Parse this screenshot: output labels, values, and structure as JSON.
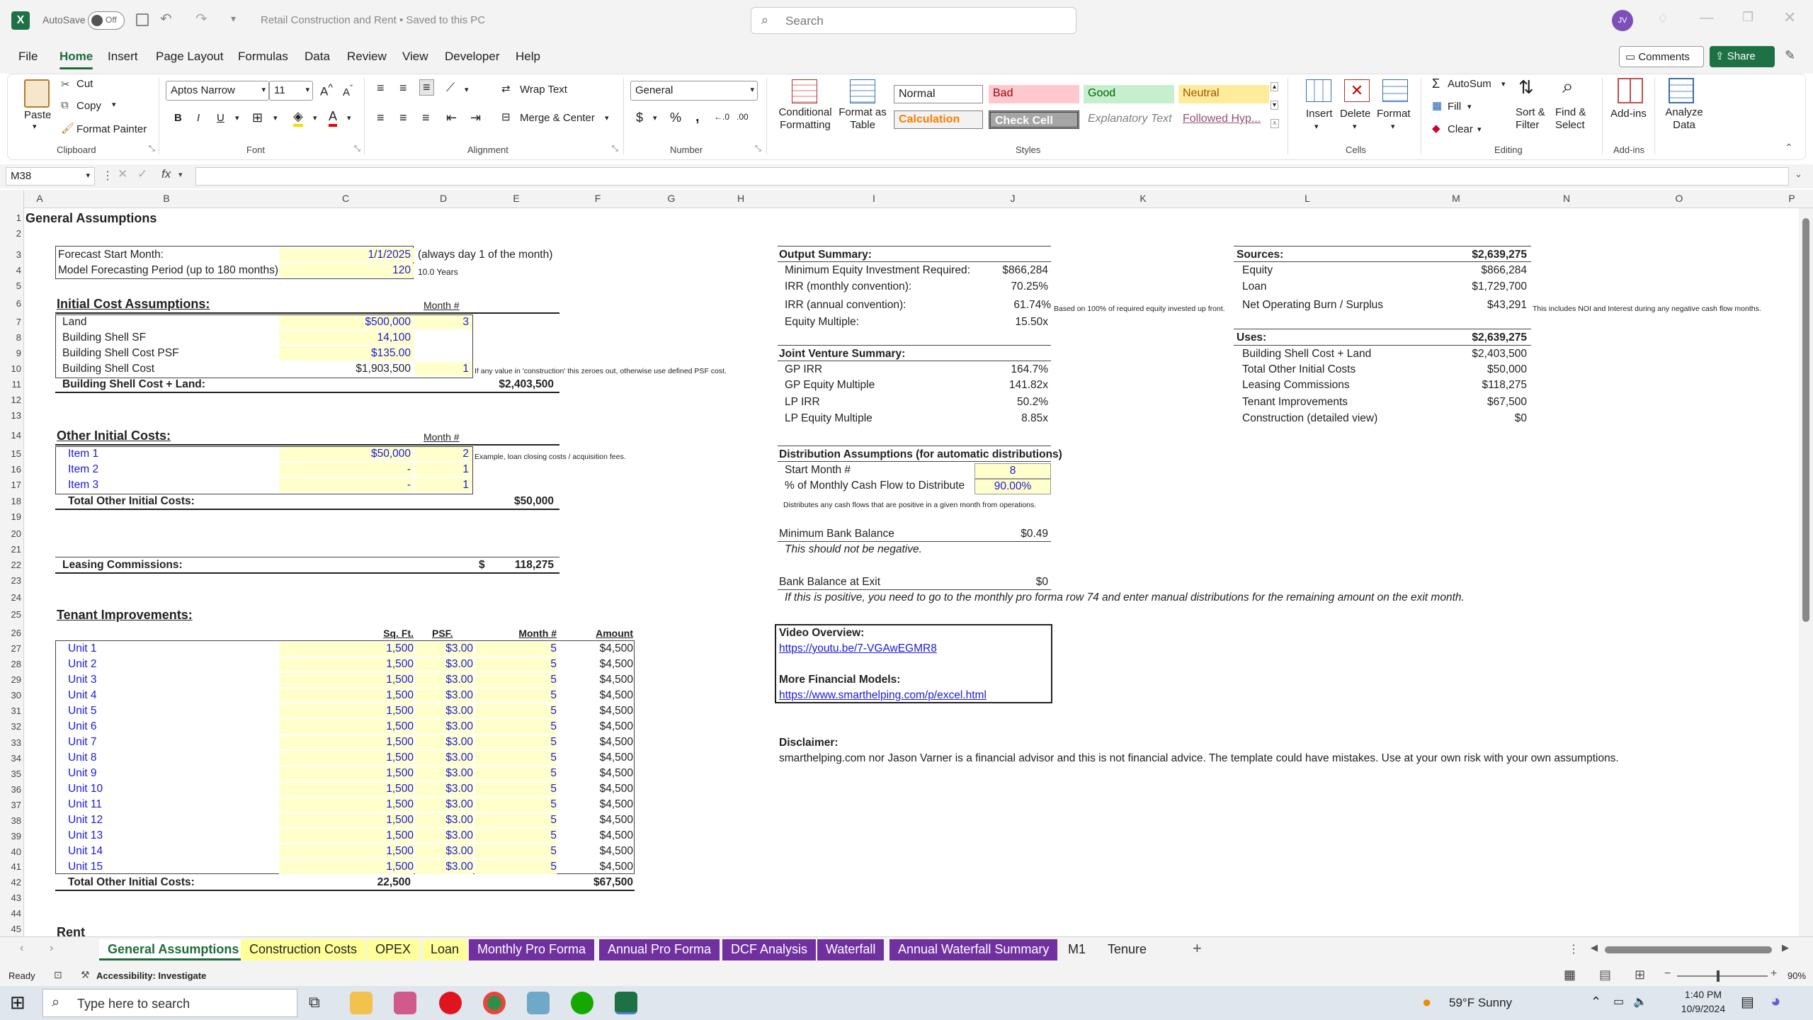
{
  "title_bar": {
    "autosave": "AutoSave",
    "autosave_state": "Off",
    "doc_title": "Retail Construction and Rent • Saved to this PC",
    "search_placeholder": "Search",
    "user_initials": "JV"
  },
  "menu": [
    "File",
    "Home",
    "Insert",
    "Page Layout",
    "Formulas",
    "Data",
    "Review",
    "View",
    "Developer",
    "Help"
  ],
  "menu_right": {
    "comments": "Comments",
    "share": "Share"
  },
  "ribbon": {
    "paste": "Paste",
    "cut": "Cut",
    "copy": "Copy",
    "format_painter": "Format Painter",
    "clipboard": "Clipboard",
    "font_name": "Aptos Narrow",
    "font_size": "11",
    "font": "Font",
    "wrap_text": "Wrap Text",
    "merge_center": "Merge & Center",
    "alignment": "Alignment",
    "number_format": "General",
    "number": "Number",
    "conditional_formatting": "Conditional Formatting",
    "format_as_table": "Format as Table",
    "styles_cells": [
      "Normal",
      "Bad",
      "Good",
      "Neutral",
      "Calculation",
      "Check Cell",
      "Explanatory Text",
      "Followed Hyp..."
    ],
    "styles": "Styles",
    "insert": "Insert",
    "delete": "Delete",
    "format": "Format",
    "cells": "Cells",
    "autosum": "AutoSum",
    "fill": "Fill",
    "clear": "Clear",
    "sort_filter": "Sort & Filter",
    "find_select": "Find & Select",
    "editing": "Editing",
    "add_ins": "Add-ins",
    "add_ins_group": "Add-ins",
    "analyze_data": "Analyze Data"
  },
  "formula_bar": {
    "name_box": "M38",
    "formula": ""
  },
  "columns": [
    "A",
    "B",
    "C",
    "D",
    "E",
    "F",
    "G",
    "H",
    "I",
    "J",
    "K",
    "L",
    "M",
    "N",
    "O",
    "P"
  ],
  "rows": [
    "1",
    "2",
    "3",
    "4",
    "5",
    "6",
    "7",
    "8",
    "9",
    "10",
    "11",
    "12",
    "13",
    "14",
    "15",
    "16",
    "17",
    "18",
    "19",
    "20",
    "21",
    "22",
    "23",
    "24",
    "25",
    "26",
    "27",
    "28",
    "29",
    "30",
    "31",
    "32",
    "33",
    "34",
    "35",
    "36",
    "37",
    "38",
    "39",
    "40",
    "41",
    "42",
    "43",
    "44",
    "45"
  ],
  "sheet": {
    "title": "General Assumptions",
    "forecast_start_label": "Forecast Start Month:",
    "forecast_start": "1/1/2025",
    "forecast_note": "(always day 1 of the month)",
    "period_label": "Model Forecasting Period (up to 180 months):",
    "period": "120",
    "period_years": "10.0 Years",
    "ica_title": "Initial Cost Assumptions:",
    "month_hdr": "Month #",
    "land_label": "Land",
    "land": "$500,000",
    "land_month": "3",
    "bs_sf_label": "Building Shell SF",
    "bs_sf": "14,100",
    "bs_psf_label": "Building Shell Cost PSF",
    "bs_psf": "$135.00",
    "bs_cost_label": "Building Shell Cost",
    "bs_cost": "$1,903,500",
    "bs_cost_month": "1",
    "bs_note": "If any value in 'construction' this zeroes out, otherwise use defined PSF cost.",
    "bs_total_label": "Building Shell Cost + Land:",
    "bs_total": "$2,403,500",
    "oic_title": "Other Initial Costs:",
    "oic_month_hdr": "Month #",
    "oic_items": [
      {
        "label": "Item 1",
        "value": "$50,000",
        "month": "2",
        "note": "Example, loan closing costs / acquisition fees."
      },
      {
        "label": "Item 2",
        "value": "-",
        "month": "1",
        "note": ""
      },
      {
        "label": "Item 3",
        "value": "-",
        "month": "1",
        "note": ""
      }
    ],
    "oic_total_label": "Total Other Initial Costs:",
    "oic_total": "$50,000",
    "lc_label": "Leasing Commissions:",
    "lc_cur": "$",
    "lc_value": "118,275",
    "ti_title": "Tenant Improvements:",
    "ti_headers": [
      "Sq. Ft.",
      "PSF.",
      "Month #",
      "Amount"
    ],
    "ti_units": [
      {
        "u": "Unit 1",
        "sf": "1,500",
        "psf": "$3.00",
        "m": "5",
        "amt": "$4,500"
      },
      {
        "u": "Unit 2",
        "sf": "1,500",
        "psf": "$3.00",
        "m": "5",
        "amt": "$4,500"
      },
      {
        "u": "Unit 3",
        "sf": "1,500",
        "psf": "$3.00",
        "m": "5",
        "amt": "$4,500"
      },
      {
        "u": "Unit 4",
        "sf": "1,500",
        "psf": "$3.00",
        "m": "5",
        "amt": "$4,500"
      },
      {
        "u": "Unit 5",
        "sf": "1,500",
        "psf": "$3.00",
        "m": "5",
        "amt": "$4,500"
      },
      {
        "u": "Unit 6",
        "sf": "1,500",
        "psf": "$3.00",
        "m": "5",
        "amt": "$4,500"
      },
      {
        "u": "Unit 7",
        "sf": "1,500",
        "psf": "$3.00",
        "m": "5",
        "amt": "$4,500"
      },
      {
        "u": "Unit 8",
        "sf": "1,500",
        "psf": "$3.00",
        "m": "5",
        "amt": "$4,500"
      },
      {
        "u": "Unit 9",
        "sf": "1,500",
        "psf": "$3.00",
        "m": "5",
        "amt": "$4,500"
      },
      {
        "u": "Unit 10",
        "sf": "1,500",
        "psf": "$3.00",
        "m": "5",
        "amt": "$4,500"
      },
      {
        "u": "Unit 11",
        "sf": "1,500",
        "psf": "$3.00",
        "m": "5",
        "amt": "$4,500"
      },
      {
        "u": "Unit 12",
        "sf": "1,500",
        "psf": "$3.00",
        "m": "5",
        "amt": "$4,500"
      },
      {
        "u": "Unit 13",
        "sf": "1,500",
        "psf": "$3.00",
        "m": "5",
        "amt": "$4,500"
      },
      {
        "u": "Unit 14",
        "sf": "1,500",
        "psf": "$3.00",
        "m": "5",
        "amt": "$4,500"
      },
      {
        "u": "Unit 15",
        "sf": "1,500",
        "psf": "$3.00",
        "m": "5",
        "amt": "$4,500"
      }
    ],
    "ti_total_label": "Total Other Initial Costs:",
    "ti_total_sf": "22,500",
    "ti_total": "$67,500",
    "rent_label": "Rent",
    "os_title": "Output Summary:",
    "os_rows": [
      {
        "l": "Minimum Equity Investment Required:",
        "v": "$866,284"
      },
      {
        "l": "IRR (monthly convention):",
        "v": "70.25%"
      },
      {
        "l": "IRR (annual convention):",
        "v": "61.74%"
      },
      {
        "l": "Equity Multiple:",
        "v": "15.50x"
      }
    ],
    "irr_note": "Based on 100% of required equity invested up front.",
    "jv_title": "Joint Venture Summary:",
    "jv_rows": [
      {
        "l": "GP IRR",
        "v": "164.7%"
      },
      {
        "l": "GP Equity Multiple",
        "v": "141.82x"
      },
      {
        "l": "LP IRR",
        "v": "50.2%"
      },
      {
        "l": "LP Equity Multiple",
        "v": "8.85x"
      }
    ],
    "da_title": "Distribution Assumptions (for automatic distributions)",
    "da_start_label": "Start Month #",
    "da_start": "8",
    "da_pct_label": "% of Monthly Cash Flow to Distribute",
    "da_pct": "90.00%",
    "da_note": "Distributes any cash flows that are positive in a given month from operations.",
    "mbb_label": "Minimum Bank Balance",
    "mbb": "$0.49",
    "mbb_note": "This should not be negative.",
    "bbe_label": "Bank Balance at Exit",
    "bbe": "$0",
    "bbe_note": "If this is positive, you need to go to the monthly pro forma row 74 and enter manual distributions for the remaining amount on the  exit month.",
    "video_label": "Video Overview:",
    "video_url": "https://youtu.be/7-VGAwEGMR8",
    "more_label": "More Financial Models:",
    "more_url": "https://www.smarthelping.com/p/excel.html",
    "disc_label": "Disclaimer:",
    "disc_text": "smarthelping.com nor Jason Varner is a financial advisor and this is not financial advice. The template could have mistakes. Use at your own risk with your own assumptions.",
    "sources_label": "Sources:",
    "sources": "$2,639,275",
    "src_rows": [
      {
        "l": "Equity",
        "v": "$866,284"
      },
      {
        "l": "Loan",
        "v": "$1,729,700"
      },
      {
        "l": "Net Operating Burn / Surplus",
        "v": "$43,291"
      }
    ],
    "src_note": "This includes NOI and Interest during any negative cash flow months.",
    "uses_label": "Uses:",
    "uses": "$2,639,275",
    "use_rows": [
      {
        "l": "Building Shell Cost + Land",
        "v": "$2,403,500"
      },
      {
        "l": "Total Other Initial Costs",
        "v": "$50,000"
      },
      {
        "l": "Leasing Commissions",
        "v": "$118,275"
      },
      {
        "l": "Tenant Improvements",
        "v": "$67,500"
      },
      {
        "l": "Construction (detailed view)",
        "v": "$0"
      }
    ]
  },
  "tabs": [
    "General Assumptions",
    "Construction Costs",
    "OPEX",
    "Loan",
    "Monthly Pro Forma",
    "Annual Pro Forma",
    "DCF Analysis",
    "Waterfall",
    "Annual Waterfall Summary",
    "M1",
    "Tenure"
  ],
  "status": {
    "ready": "Ready",
    "accessibility": "Accessibility: Investigate",
    "zoom": "90%"
  },
  "taskbar": {
    "search": "Type here to search",
    "weather": "59°F  Sunny",
    "time": "1:40 PM",
    "date": "10/9/2024"
  }
}
